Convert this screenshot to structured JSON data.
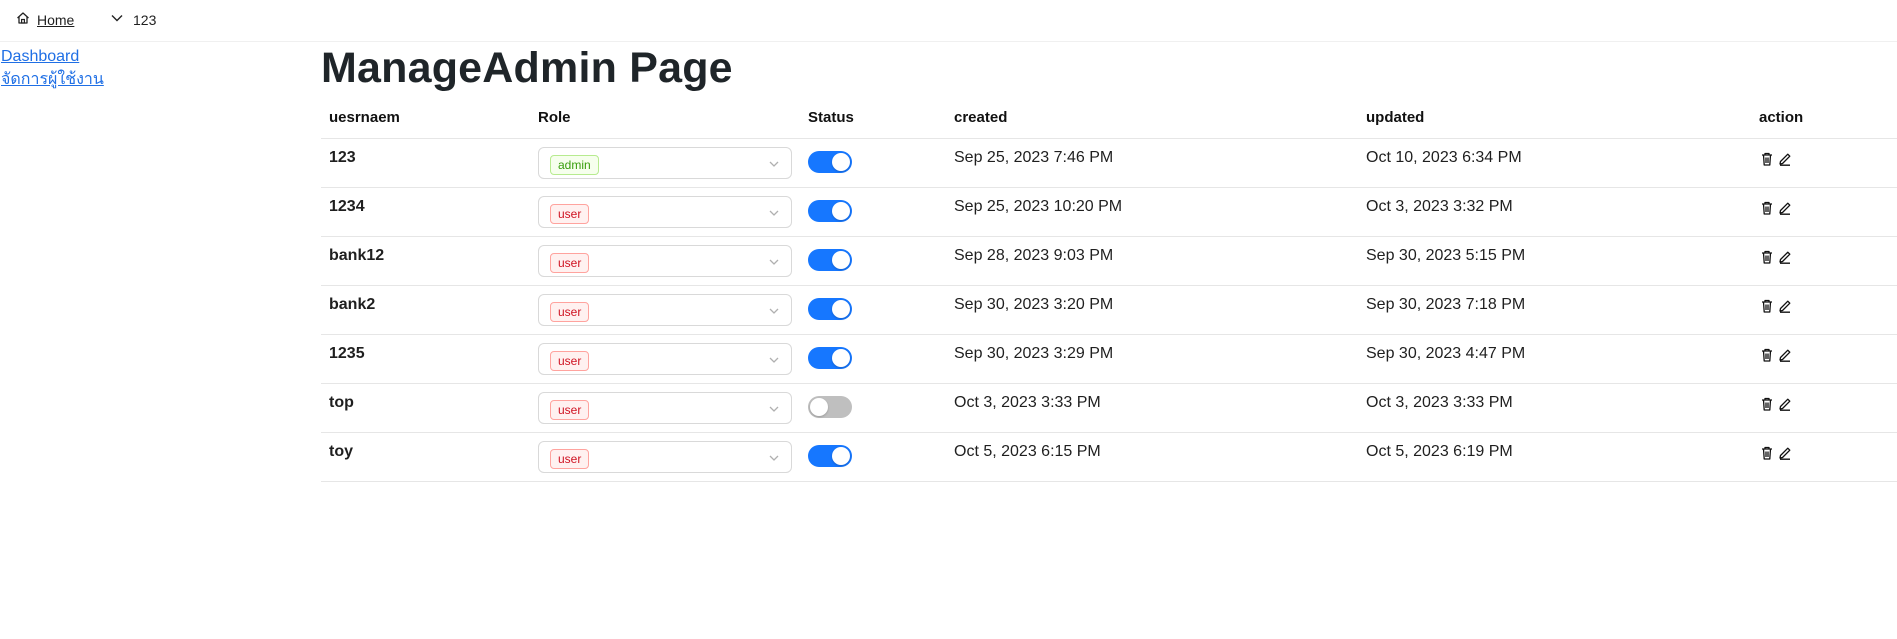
{
  "breadcrumb": {
    "home_label": "Home",
    "user_label": "123"
  },
  "sidebar": {
    "items": [
      {
        "label": "Dashboard"
      },
      {
        "label": "จัดการผู้ใช้งาน"
      }
    ]
  },
  "page": {
    "title": "ManageAdmin Page"
  },
  "table": {
    "headers": {
      "username": "uesrnaem",
      "role": "Role",
      "status": "Status",
      "created": "created",
      "updated": "updated",
      "action": "action"
    },
    "rows": [
      {
        "username": "123",
        "role": "admin",
        "status_on": true,
        "created": "Sep 25, 2023 7:46 PM",
        "updated": "Oct 10, 2023 6:34 PM"
      },
      {
        "username": "1234",
        "role": "user",
        "status_on": true,
        "created": "Sep 25, 2023 10:20 PM",
        "updated": "Oct 3, 2023 3:32 PM"
      },
      {
        "username": "bank12",
        "role": "user",
        "status_on": true,
        "created": "Sep 28, 2023 9:03 PM",
        "updated": "Sep 30, 2023 5:15 PM"
      },
      {
        "username": "bank2",
        "role": "user",
        "status_on": true,
        "created": "Sep 30, 2023 3:20 PM",
        "updated": "Sep 30, 2023 7:18 PM"
      },
      {
        "username": "1235",
        "role": "user",
        "status_on": true,
        "created": "Sep 30, 2023 3:29 PM",
        "updated": "Sep 30, 2023 4:47 PM"
      },
      {
        "username": "top",
        "role": "user",
        "status_on": false,
        "created": "Oct 3, 2023 3:33 PM",
        "updated": "Oct 3, 2023 3:33 PM"
      },
      {
        "username": "toy",
        "role": "user",
        "status_on": true,
        "created": "Oct 5, 2023 6:15 PM",
        "updated": "Oct 5, 2023 6:19 PM"
      }
    ]
  },
  "colors": {
    "link": "#1f6fe5",
    "toggle_on": "#1677ff",
    "toggle_off": "#bfbfbf",
    "admin_tag": "#389e0d",
    "user_tag": "#cf1322"
  },
  "icons": {
    "breadcrumb_home": "home-icon",
    "breadcrumb_user": "chevron-down-icon",
    "select_arrow": "chevron-down-icon",
    "delete": "trash-icon",
    "edit": "pencil-icon"
  }
}
